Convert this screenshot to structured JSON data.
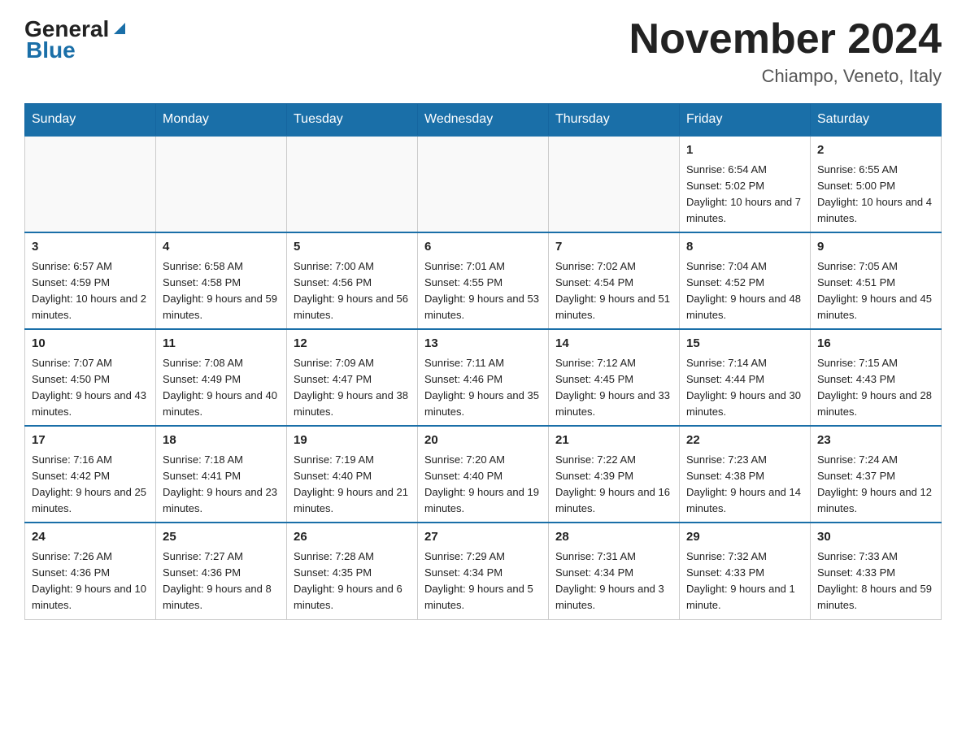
{
  "header": {
    "logo_general": "General",
    "logo_blue": "Blue",
    "month_title": "November 2024",
    "location": "Chiampo, Veneto, Italy"
  },
  "weekdays": [
    "Sunday",
    "Monday",
    "Tuesday",
    "Wednesday",
    "Thursday",
    "Friday",
    "Saturday"
  ],
  "weeks": [
    [
      {
        "day": "",
        "info": ""
      },
      {
        "day": "",
        "info": ""
      },
      {
        "day": "",
        "info": ""
      },
      {
        "day": "",
        "info": ""
      },
      {
        "day": "",
        "info": ""
      },
      {
        "day": "1",
        "info": "Sunrise: 6:54 AM\nSunset: 5:02 PM\nDaylight: 10 hours and 7 minutes."
      },
      {
        "day": "2",
        "info": "Sunrise: 6:55 AM\nSunset: 5:00 PM\nDaylight: 10 hours and 4 minutes."
      }
    ],
    [
      {
        "day": "3",
        "info": "Sunrise: 6:57 AM\nSunset: 4:59 PM\nDaylight: 10 hours and 2 minutes."
      },
      {
        "day": "4",
        "info": "Sunrise: 6:58 AM\nSunset: 4:58 PM\nDaylight: 9 hours and 59 minutes."
      },
      {
        "day": "5",
        "info": "Sunrise: 7:00 AM\nSunset: 4:56 PM\nDaylight: 9 hours and 56 minutes."
      },
      {
        "day": "6",
        "info": "Sunrise: 7:01 AM\nSunset: 4:55 PM\nDaylight: 9 hours and 53 minutes."
      },
      {
        "day": "7",
        "info": "Sunrise: 7:02 AM\nSunset: 4:54 PM\nDaylight: 9 hours and 51 minutes."
      },
      {
        "day": "8",
        "info": "Sunrise: 7:04 AM\nSunset: 4:52 PM\nDaylight: 9 hours and 48 minutes."
      },
      {
        "day": "9",
        "info": "Sunrise: 7:05 AM\nSunset: 4:51 PM\nDaylight: 9 hours and 45 minutes."
      }
    ],
    [
      {
        "day": "10",
        "info": "Sunrise: 7:07 AM\nSunset: 4:50 PM\nDaylight: 9 hours and 43 minutes."
      },
      {
        "day": "11",
        "info": "Sunrise: 7:08 AM\nSunset: 4:49 PM\nDaylight: 9 hours and 40 minutes."
      },
      {
        "day": "12",
        "info": "Sunrise: 7:09 AM\nSunset: 4:47 PM\nDaylight: 9 hours and 38 minutes."
      },
      {
        "day": "13",
        "info": "Sunrise: 7:11 AM\nSunset: 4:46 PM\nDaylight: 9 hours and 35 minutes."
      },
      {
        "day": "14",
        "info": "Sunrise: 7:12 AM\nSunset: 4:45 PM\nDaylight: 9 hours and 33 minutes."
      },
      {
        "day": "15",
        "info": "Sunrise: 7:14 AM\nSunset: 4:44 PM\nDaylight: 9 hours and 30 minutes."
      },
      {
        "day": "16",
        "info": "Sunrise: 7:15 AM\nSunset: 4:43 PM\nDaylight: 9 hours and 28 minutes."
      }
    ],
    [
      {
        "day": "17",
        "info": "Sunrise: 7:16 AM\nSunset: 4:42 PM\nDaylight: 9 hours and 25 minutes."
      },
      {
        "day": "18",
        "info": "Sunrise: 7:18 AM\nSunset: 4:41 PM\nDaylight: 9 hours and 23 minutes."
      },
      {
        "day": "19",
        "info": "Sunrise: 7:19 AM\nSunset: 4:40 PM\nDaylight: 9 hours and 21 minutes."
      },
      {
        "day": "20",
        "info": "Sunrise: 7:20 AM\nSunset: 4:40 PM\nDaylight: 9 hours and 19 minutes."
      },
      {
        "day": "21",
        "info": "Sunrise: 7:22 AM\nSunset: 4:39 PM\nDaylight: 9 hours and 16 minutes."
      },
      {
        "day": "22",
        "info": "Sunrise: 7:23 AM\nSunset: 4:38 PM\nDaylight: 9 hours and 14 minutes."
      },
      {
        "day": "23",
        "info": "Sunrise: 7:24 AM\nSunset: 4:37 PM\nDaylight: 9 hours and 12 minutes."
      }
    ],
    [
      {
        "day": "24",
        "info": "Sunrise: 7:26 AM\nSunset: 4:36 PM\nDaylight: 9 hours and 10 minutes."
      },
      {
        "day": "25",
        "info": "Sunrise: 7:27 AM\nSunset: 4:36 PM\nDaylight: 9 hours and 8 minutes."
      },
      {
        "day": "26",
        "info": "Sunrise: 7:28 AM\nSunset: 4:35 PM\nDaylight: 9 hours and 6 minutes."
      },
      {
        "day": "27",
        "info": "Sunrise: 7:29 AM\nSunset: 4:34 PM\nDaylight: 9 hours and 5 minutes."
      },
      {
        "day": "28",
        "info": "Sunrise: 7:31 AM\nSunset: 4:34 PM\nDaylight: 9 hours and 3 minutes."
      },
      {
        "day": "29",
        "info": "Sunrise: 7:32 AM\nSunset: 4:33 PM\nDaylight: 9 hours and 1 minute."
      },
      {
        "day": "30",
        "info": "Sunrise: 7:33 AM\nSunset: 4:33 PM\nDaylight: 8 hours and 59 minutes."
      }
    ]
  ]
}
